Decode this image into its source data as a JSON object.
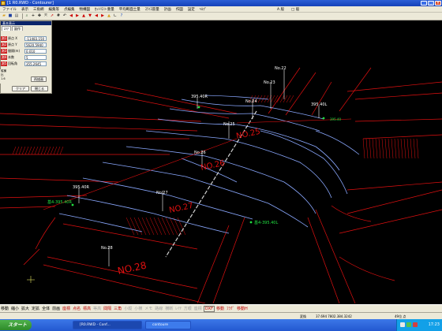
{
  "window": {
    "title": "[1 R0.RWD - Contourer]"
  },
  "menu": {
    "items": [
      "ファイル",
      "表示",
      "三角網",
      "編集等",
      "点編集",
      "物構図",
      "ｶｯﾄﾘｽト重量",
      "平均断面土量",
      "ｽﾗｲｽ容量",
      "計画",
      "作図",
      "設定",
      "ﾍﾙﾌﾟ"
    ],
    "extra": [
      "A 般",
      "□ 般"
    ]
  },
  "panel": {
    "title": "基本表示",
    "tabs": [
      "ｴﾘｱ",
      "副作"
    ],
    "rows": [
      {
        "side": "測1",
        "label": "原点 X",
        "value": "-11483.150"
      },
      {
        "side": "測2",
        "label": "原点 Y",
        "value": "5620.5940"
      },
      {
        "side": "測3",
        "label": "間隔(m)",
        "value": "0.010"
      },
      {
        "side": "測4",
        "label": "本数",
        "value": "5"
      },
      {
        "side": "測5",
        "label": "回転角",
        "value": "355.2645"
      }
    ],
    "redraw_button": "再描画",
    "clear_button": "クリア",
    "close_button": "閉じる",
    "strip_text": [
      "縦横比",
      "1.6"
    ]
  },
  "drawing": {
    "labels": {
      "no22": "No.22",
      "no23": "No.23",
      "no24": "No.24",
      "no25": "No.25",
      "no26": "No.26",
      "no27": "No.27",
      "no28": "No.28",
      "no25_big": "NO.25",
      "no26_big": "NO.26",
      "no27_big": "NO.27",
      "no28_big": "NO.28",
      "z395r": "395.40R",
      "z395l": "395.40L",
      "z395l2": "395.40L",
      "z395r2": "395.40R",
      "base_left": "基4-395.40R",
      "base_right": "基4-395.40L",
      "base_top": "395.40"
    },
    "colors": {
      "road": "#e01010",
      "contour": "#8aa8ff",
      "marker": "#20e040",
      "white": "#ffffff"
    }
  },
  "commands": {
    "items": [
      {
        "label": "移動",
        "style": "normal"
      },
      {
        "label": "縮小",
        "style": "normal"
      },
      {
        "label": "拡大",
        "style": "normal"
      },
      {
        "label": "定拡",
        "style": "normal"
      },
      {
        "label": "全体",
        "style": "normal"
      },
      {
        "label": "前画",
        "style": "normal"
      },
      {
        "label": "座標",
        "style": "red"
      },
      {
        "label": "点名",
        "style": "red"
      },
      {
        "label": "標高",
        "style": "red"
      },
      {
        "label": "等高",
        "style": "gray"
      },
      {
        "label": "間隔",
        "style": "red"
      },
      {
        "label": "三角",
        "style": "red"
      },
      {
        "label": "小縦",
        "style": "gray"
      },
      {
        "label": "小横",
        "style": "gray"
      },
      {
        "label": "メモ",
        "style": "gray"
      },
      {
        "label": "路線",
        "style": "gray"
      },
      {
        "label": "横断",
        "style": "gray"
      },
      {
        "label": "ﾚｲﾔ",
        "style": "gray"
      },
      {
        "label": "方眼",
        "style": "gray"
      },
      {
        "label": "座標",
        "style": "gray"
      },
      {
        "label": "DXF",
        "style": "boxed-red"
      },
      {
        "label": "移動",
        "style": "red"
      },
      {
        "label": "ﾌﾗｸﾞ",
        "style": "red"
      },
      {
        "label": "移動H",
        "style": "red"
      }
    ]
  },
  "status": {
    "left": "変換",
    "coords": "37.694 7802.384.3242",
    "zoom": "49位 点"
  },
  "taskbar": {
    "start": "スタート",
    "tasks": [
      "[R0.RWD - Conf...",
      "contoure"
    ],
    "clock": "17:23"
  }
}
